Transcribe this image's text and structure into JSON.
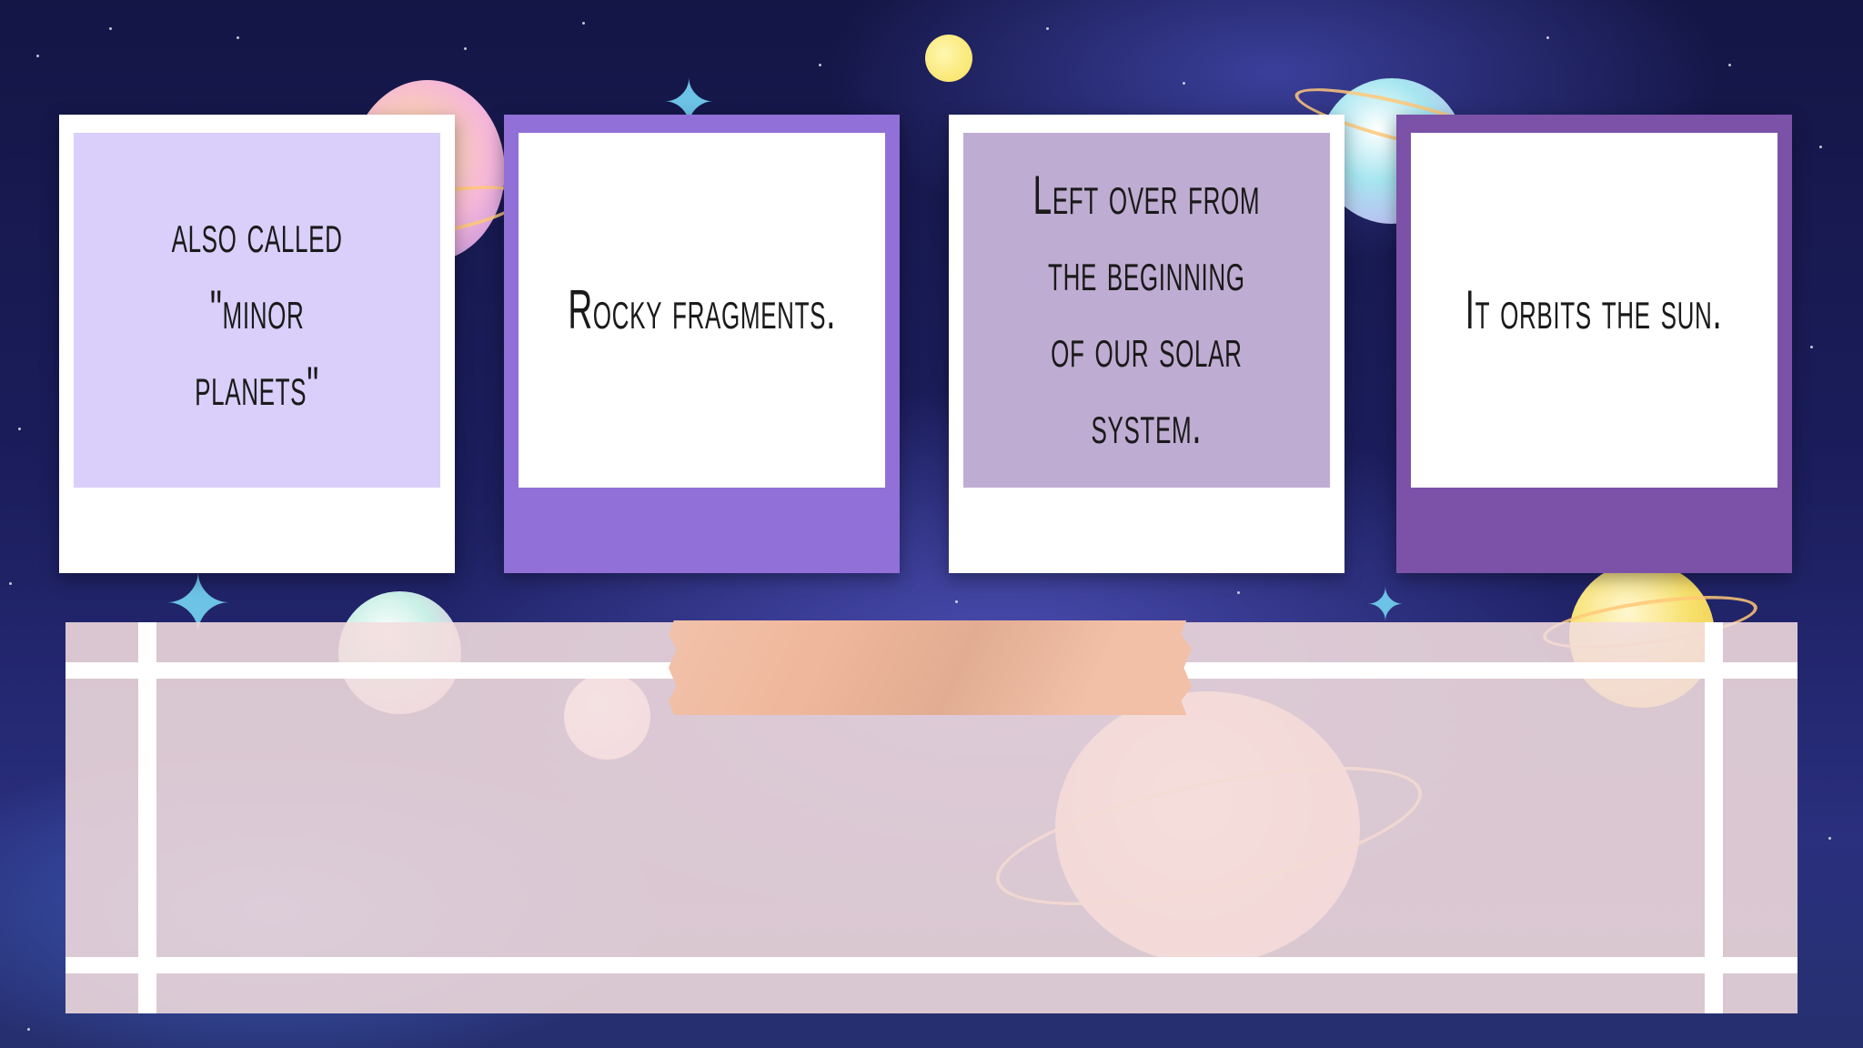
{
  "slide": {
    "background": "space-illustration",
    "cards": [
      {
        "text_lines": [
          "also called",
          "\"minor",
          "planets\""
        ],
        "frame_color": "#ffffff",
        "inner_color": "#d9cffa"
      },
      {
        "text_lines": [
          "Rocky fragments."
        ],
        "frame_color": "#9170d8",
        "inner_color": "#ffffff"
      },
      {
        "text_lines": [
          "Left over from",
          "the beginning",
          "of our solar",
          "system."
        ],
        "frame_color": "#ffffff",
        "inner_color": "#bfacd2"
      },
      {
        "text_lines": [
          "It orbits the sun."
        ],
        "frame_color": "#7b52a8",
        "inner_color": "#ffffff"
      }
    ],
    "panel": {
      "color": "#f3ddde",
      "tape_color": "#efb79b"
    }
  }
}
